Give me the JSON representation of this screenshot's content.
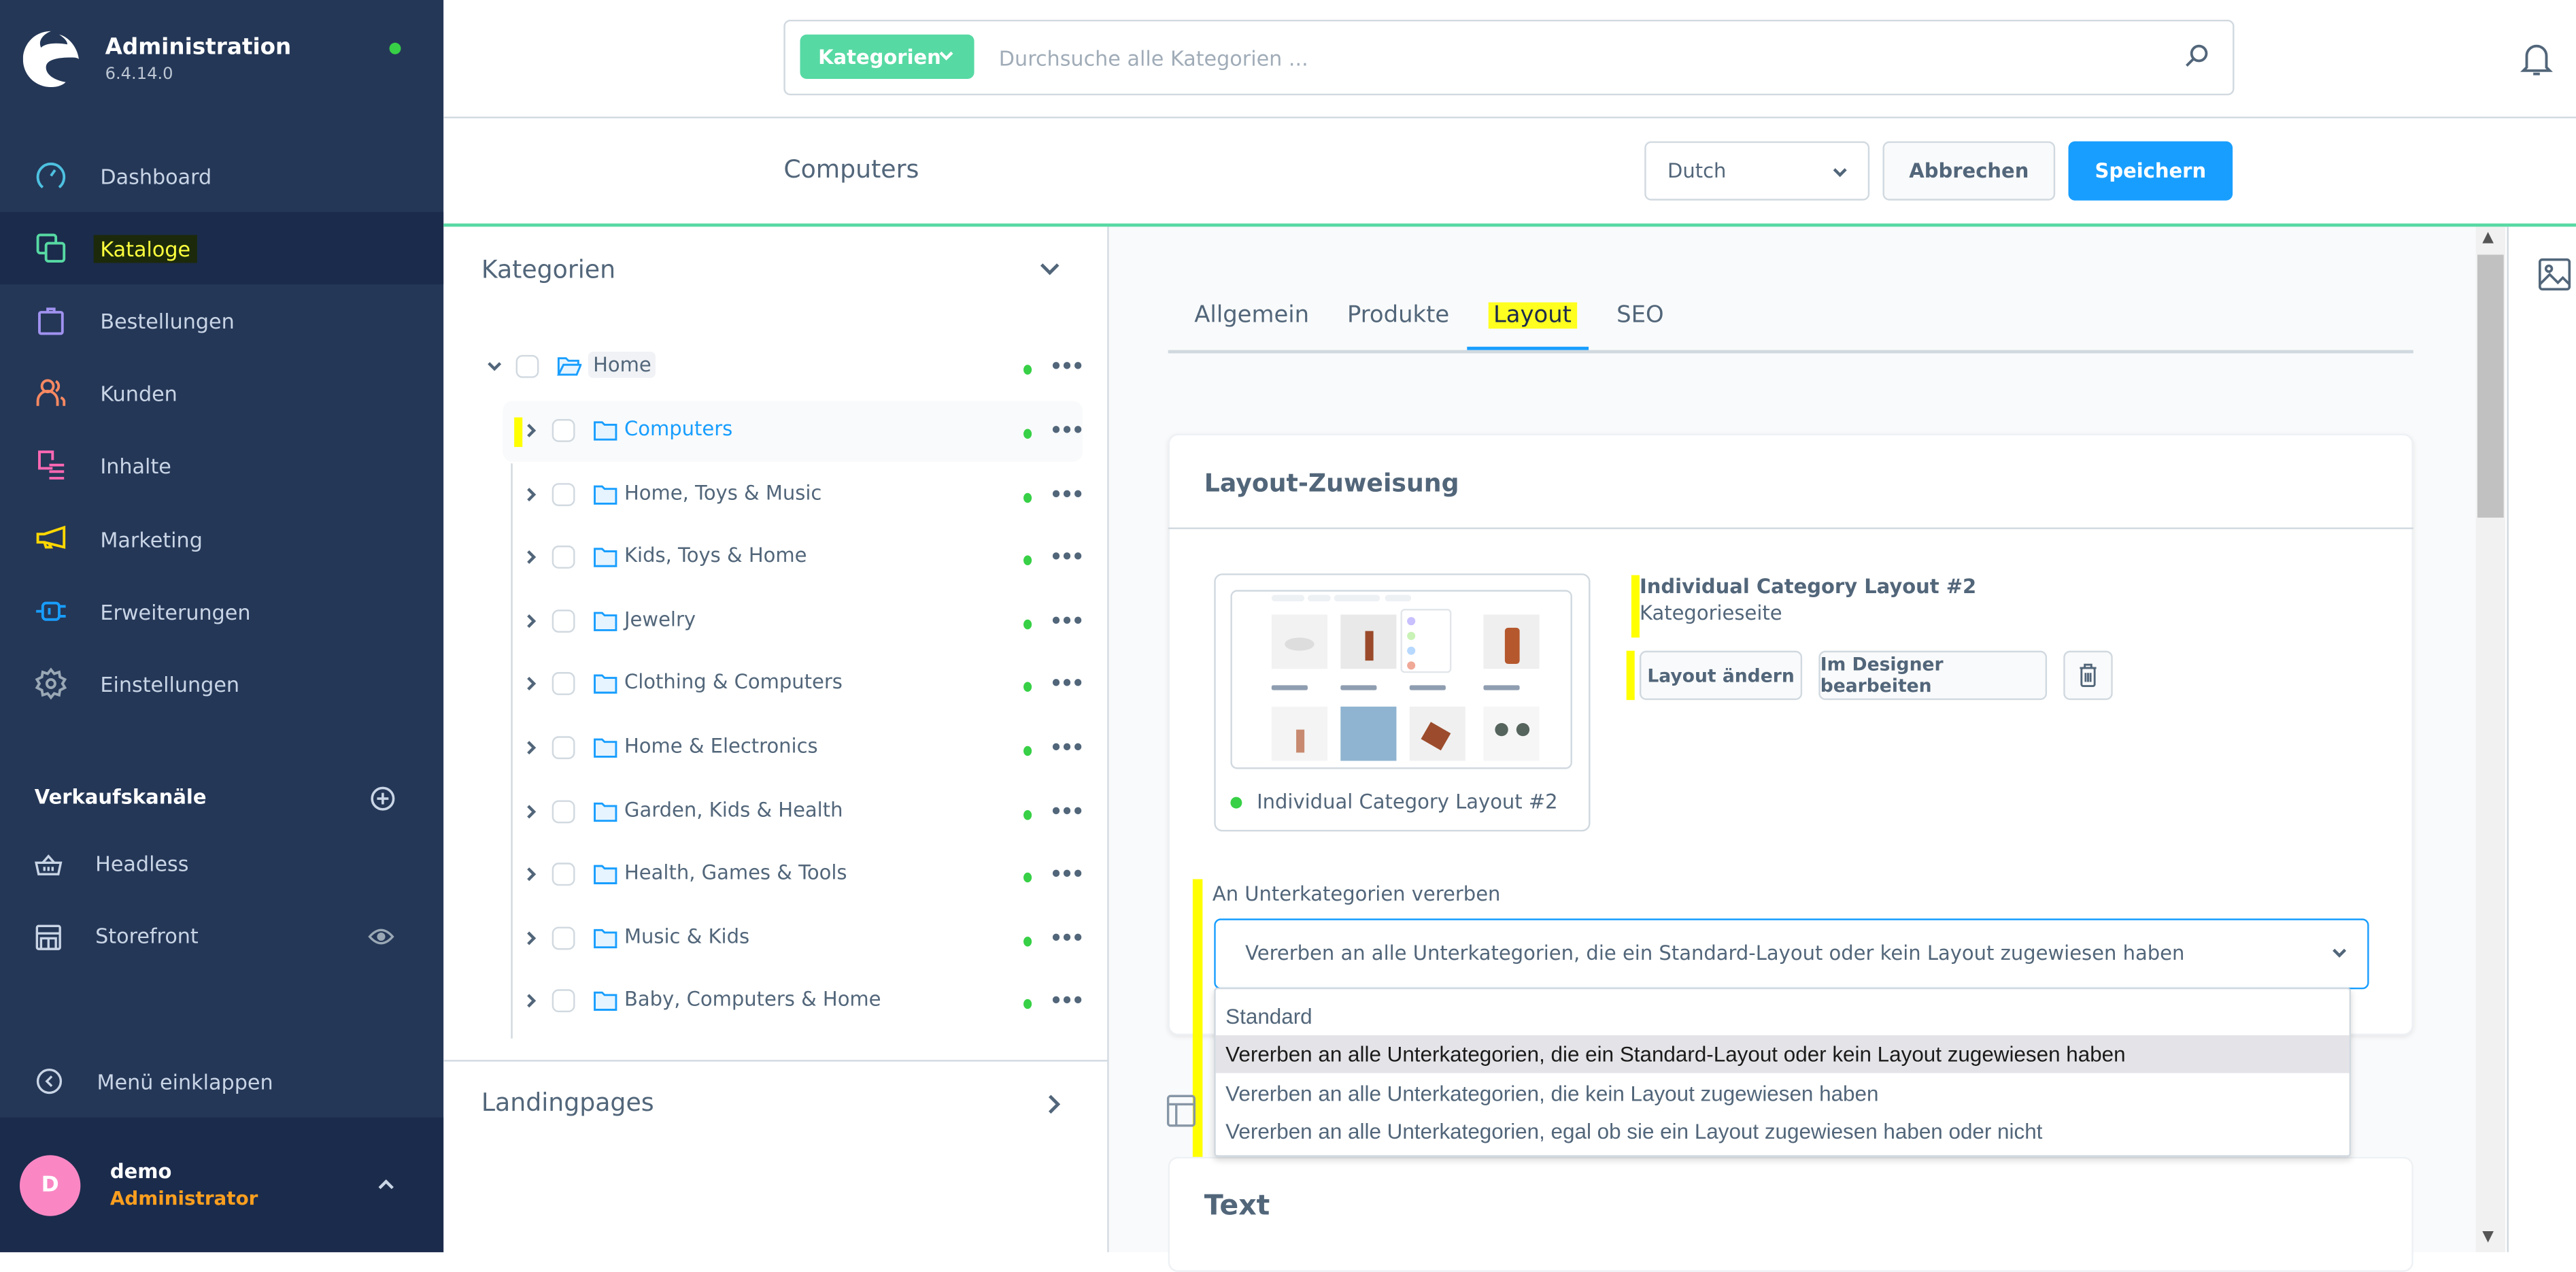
{
  "app": {
    "title": "Administration",
    "version": "6.4.14.0"
  },
  "sidebar": {
    "items": [
      {
        "label": "Dashboard",
        "icon": "dashboard-icon",
        "color": "#4ec1e0"
      },
      {
        "label": "Kataloge",
        "icon": "catalogue-icon",
        "color": "#57d9a3",
        "active": true
      },
      {
        "label": "Bestellungen",
        "icon": "orders-icon",
        "color": "#a092f0"
      },
      {
        "label": "Kunden",
        "icon": "customers-icon",
        "color": "#f88962"
      },
      {
        "label": "Inhalte",
        "icon": "content-icon",
        "color": "#ff68b4"
      },
      {
        "label": "Marketing",
        "icon": "marketing-icon",
        "color": "#ffd700"
      },
      {
        "label": "Erweiterungen",
        "icon": "extensions-icon",
        "color": "#189eff"
      },
      {
        "label": "Einstellungen",
        "icon": "settings-icon",
        "color": "#9aa8b5"
      }
    ],
    "sales_channels_title": "Verkaufskanäle",
    "sales_channels": [
      {
        "label": "Headless",
        "icon": "basket-icon"
      },
      {
        "label": "Storefront",
        "icon": "storefront-icon"
      }
    ],
    "collapse_label": "Menü einklappen",
    "user": {
      "initial": "D",
      "name": "demo",
      "role": "Administrator"
    }
  },
  "search": {
    "type_label": "Kategorien",
    "placeholder": "Durchsuche alle Kategorien ..."
  },
  "smartbar": {
    "title": "Computers",
    "language": "Dutch",
    "cancel_label": "Abbrechen",
    "save_label": "Speichern"
  },
  "tree": {
    "title": "Kategorien",
    "root": "Home",
    "children": [
      {
        "label": "Computers",
        "active": true
      },
      {
        "label": "Home, Toys & Music"
      },
      {
        "label": "Kids, Toys & Home"
      },
      {
        "label": "Jewelry"
      },
      {
        "label": "Clothing & Computers"
      },
      {
        "label": "Home & Electronics"
      },
      {
        "label": "Garden, Kids & Health"
      },
      {
        "label": "Health, Games & Tools"
      },
      {
        "label": "Music & Kids"
      },
      {
        "label": "Baby, Computers & Home"
      }
    ],
    "landingpages_title": "Landingpages"
  },
  "tabs": [
    {
      "label": "Allgemein"
    },
    {
      "label": "Produkte"
    },
    {
      "label": "Layout",
      "active": true
    },
    {
      "label": "SEO"
    }
  ],
  "layout_card": {
    "title": "Layout-Zuweisung",
    "layout_name": "Individual Category Layout #2",
    "layout_type": "Kategorieseite",
    "preview_caption": "Individual Category Layout #2",
    "change_label": "Layout ändern",
    "designer_label": "Im Designer bearbeiten",
    "inherit_label": "An Unterkategorien vererben",
    "inherit_value": "Vererben an alle Unterkategorien, die ein Standard-Layout oder kein Layout zugewiesen haben",
    "inherit_options": [
      "Standard",
      "Vererben an alle Unterkategorien, die ein Standard-Layout oder kein Layout zugewiesen haben",
      "Vererben an alle Unterkategorien, die kein Layout zugewiesen haben",
      "Vererben an alle Unterkategorien, egal ob sie ein Layout zugewiesen haben oder nicht"
    ],
    "highlighted_option_index": 1
  },
  "text_card": {
    "title": "Text"
  }
}
